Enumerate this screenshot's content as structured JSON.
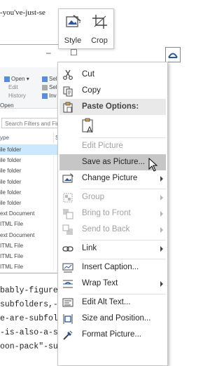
{
  "document": {
    "top_line": "-you've-just-se",
    "bottom_lines": [
      "bably-figure-ou",
      "subfolders,-tho",
      "e-are-subfolde",
      "-is-also-a-subf",
      "oon-pack\"-subf"
    ]
  },
  "explorer": {
    "ribbon": {
      "open": "Open ▾",
      "edit": "Edit",
      "history": "History",
      "open_group": "Open",
      "sel1": "Sel",
      "sel2": "Sel",
      "inv": "Inv"
    },
    "search_placeholder": "Search Filters and Fin",
    "columns": [
      "ype",
      "S"
    ],
    "rows": [
      "ile folder",
      "ile folder",
      "ile folder",
      "ile folder",
      "ile folder",
      "ile folder",
      "ext Document",
      "ITML File",
      "ext Document",
      "ITML File",
      "ITML File",
      "ITML File"
    ],
    "selected_row": 0
  },
  "picture_toolbar": {
    "style_label": "Style",
    "crop_label": "Crop"
  },
  "context_menu": {
    "items": [
      {
        "label": "Cut",
        "icon": "scissors-icon",
        "state": "normal"
      },
      {
        "label": "Copy",
        "icon": "copy-icon",
        "state": "normal"
      },
      {
        "label": "Paste Options:",
        "icon": "clipboard-icon",
        "state": "header"
      },
      {
        "label": "Edit Picture",
        "icon": "",
        "state": "disabled"
      },
      {
        "label": "Save as Picture...",
        "icon": "",
        "state": "hover"
      },
      {
        "label": "Change Picture",
        "icon": "change-picture-icon",
        "state": "submenu"
      },
      {
        "label": "Group",
        "icon": "group-icon",
        "state": "disabled-submenu"
      },
      {
        "label": "Bring to Front",
        "icon": "bring-front-icon",
        "state": "disabled-submenu"
      },
      {
        "label": "Send to Back",
        "icon": "send-back-icon",
        "state": "disabled-submenu"
      },
      {
        "label": "Link",
        "icon": "link-icon",
        "state": "submenu"
      },
      {
        "label": "Insert Caption...",
        "icon": "caption-icon",
        "state": "normal"
      },
      {
        "label": "Wrap Text",
        "icon": "wrap-text-icon",
        "state": "submenu"
      },
      {
        "label": "Edit Alt Text...",
        "icon": "alt-text-icon",
        "state": "normal"
      },
      {
        "label": "Size and Position...",
        "icon": "size-position-icon",
        "state": "normal"
      },
      {
        "label": "Format Picture...",
        "icon": "format-picture-icon",
        "state": "normal"
      }
    ]
  },
  "colors": {
    "hover_bg": "#c6c6c6",
    "header_bg": "#e9e9e9",
    "selection_blue": "#cce8ff",
    "icon_blue": "#2b579a"
  }
}
